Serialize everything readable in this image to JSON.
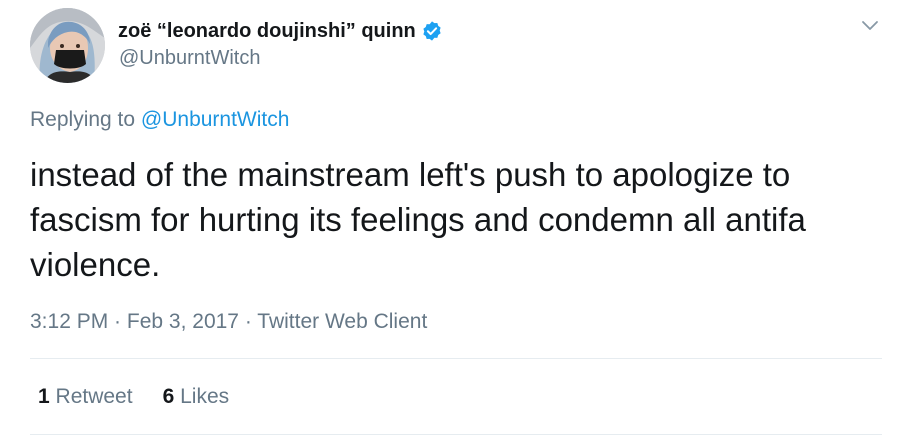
{
  "tweet": {
    "author": {
      "display_name": "zoë “leonardo doujinshi” quinn",
      "handle": "@UnburntWitch",
      "verified": true
    },
    "replying_to": {
      "prefix": "Replying to",
      "mention": "@UnburntWitch"
    },
    "text": "instead of the mainstream left's push to apologize to fascism for hurting its feelings and condemn all antifa violence.",
    "meta": {
      "time": "3:12 PM",
      "separator1": " · ",
      "date": "Feb 3, 2017",
      "separator2": " · ",
      "source": "Twitter Web Client"
    },
    "stats": {
      "retweets_count": "1",
      "retweets_label": "Retweet",
      "likes_count": "6",
      "likes_label": "Likes"
    }
  },
  "icons": {
    "verified": "verified-badge-icon",
    "caret": "chevron-down-icon"
  },
  "colors": {
    "text_primary": "#14171a",
    "text_secondary": "#657786",
    "link": "#1b95e0",
    "verified_blue": "#1da1f2",
    "divider": "#e6ecf0"
  }
}
